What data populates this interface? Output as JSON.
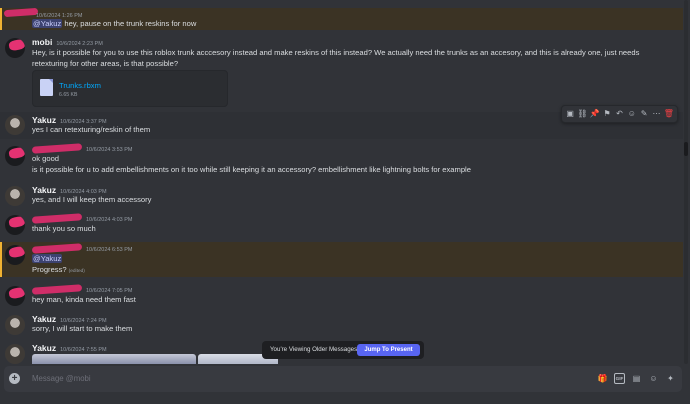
{
  "messages": [
    {
      "user": "",
      "time": "10/6/2024 1:26 PM",
      "mention": "@Yakuz",
      "text": " hey, pause on the trunk reskins for now"
    },
    {
      "user": "mobi",
      "time": "10/6/2024 2:23 PM",
      "text": "Hey, is it possible for you to use this roblox trunk acccesory instead and make reskins of this instead? We actually need the trunks as an accesory, and this is already one, just needs retexturing for other areas, is that possible?"
    },
    {
      "user": "Yakuz",
      "time": "10/6/2024 3:37 PM",
      "text": "yes I can retexturing/reskin of them"
    },
    {
      "user": "",
      "time": "10/6/2024 3:53 PM",
      "text": "ok good"
    },
    {
      "text": "is it possible for u to add embellishments on it too while still keeping it an accessory? embellishment like lightning bolts for example"
    },
    {
      "user": "Yakuz",
      "time": "10/6/2024 4:03 PM",
      "text": "yes, and I will keep them accessory"
    },
    {
      "user": "",
      "time": "10/6/2024 4:03 PM",
      "text": "thank you so much"
    },
    {
      "user": "",
      "time": "10/6/2024 6:53 PM",
      "mention": "@Yakuz",
      "text": "Progress?",
      "edited": "(edited)"
    },
    {
      "user": "",
      "time": "10/6/2024 7:05 PM",
      "text": "hey man, kinda need them fast"
    },
    {
      "user": "Yakuz",
      "time": "10/6/2024 7:24 PM",
      "text": "sorry, I will start to make them"
    },
    {
      "user": "Yakuz",
      "time": "10/6/2024 7:55 PM"
    }
  ],
  "attachment": {
    "name": "Trunks.rbxm",
    "size": "6.65 KB"
  },
  "banner": {
    "text": "You're Viewing Older Messages",
    "button": "Jump To Present"
  },
  "composer": {
    "placeholder": "Message @mobi"
  },
  "colors": {
    "accent": "#5865f2",
    "mention_bg": "#3c4270",
    "highlight_bar": "#f0b232",
    "delete": "#f23f43",
    "link": "#00a8fc"
  },
  "toolbar_icons": [
    "app-icon",
    "link-icon",
    "pin-icon",
    "bookmark-icon",
    "reply-icon",
    "emoji-icon",
    "edit-icon",
    "more-icon",
    "delete-icon"
  ]
}
